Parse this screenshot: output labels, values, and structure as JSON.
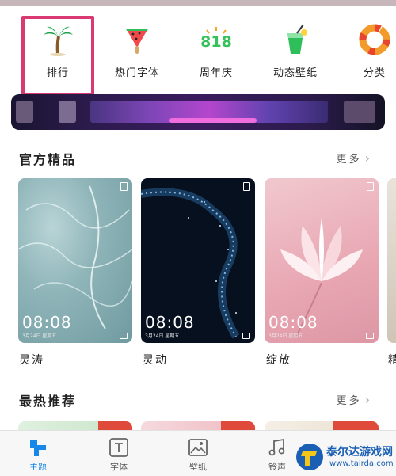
{
  "categories": [
    {
      "label": "排行",
      "icon": "palm-tree-icon"
    },
    {
      "label": "热门字体",
      "icon": "watermelon-popsicle-icon"
    },
    {
      "label": "周年庆",
      "icon": "818-anniversary-icon"
    },
    {
      "label": "动态壁纸",
      "icon": "drink-cup-icon"
    },
    {
      "label": "分类",
      "icon": "lifebuoy-icon"
    }
  ],
  "official": {
    "title": "官方精品",
    "more": "更多",
    "cards": [
      {
        "name": "灵涛",
        "time": "08:08",
        "date": "3月24日 星期五"
      },
      {
        "name": "灵动",
        "time": "08:08",
        "date": "3月24日 星期五"
      },
      {
        "name": "绽放",
        "time": "08:08",
        "date": "3月24日 星期五"
      },
      {
        "name": "精"
      }
    ]
  },
  "hot": {
    "title": "最热推荐",
    "more": "更多"
  },
  "tabs": [
    {
      "label": "主题",
      "icon": "theme-icon",
      "active": true
    },
    {
      "label": "字体",
      "icon": "font-icon"
    },
    {
      "label": "壁纸",
      "icon": "wallpaper-icon"
    },
    {
      "label": "铃声",
      "icon": "music-note-icon"
    }
  ],
  "watermark": {
    "title": "泰尔达游戏网",
    "url": "www.tairda.com"
  },
  "colors": {
    "highlight": "#d93a72",
    "active_tab": "#1787e8"
  }
}
